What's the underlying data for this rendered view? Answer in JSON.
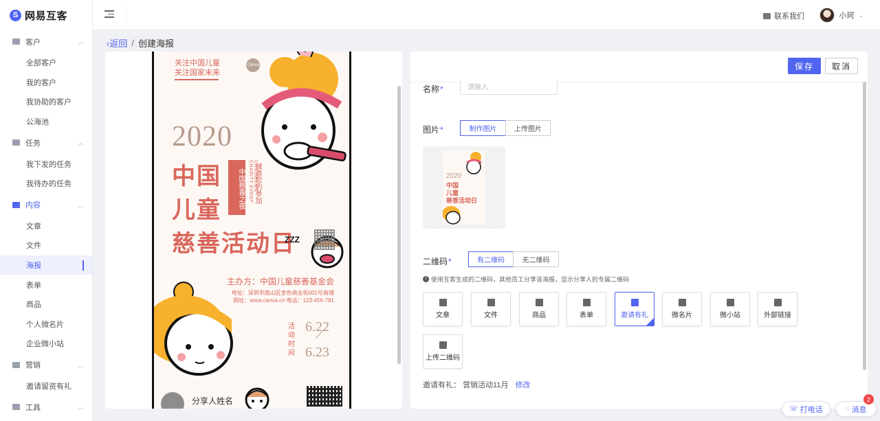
{
  "app": {
    "logo_text": "网易互客"
  },
  "sidebar": {
    "groups": [
      {
        "label": "客户",
        "items": [
          "全部客户",
          "我的客户",
          "我协助的客户",
          "公海池"
        ]
      },
      {
        "label": "任务",
        "items": [
          "我下发的任务",
          "我待办的任务"
        ]
      },
      {
        "label": "内容",
        "items": [
          "文章",
          "文件",
          "海报",
          "表单",
          "商品",
          "个人微名片",
          "企业微小站"
        ]
      },
      {
        "label": "营销",
        "items": [
          "邀请留资有礼"
        ]
      },
      {
        "label": "工具",
        "items": []
      }
    ],
    "active_item": "海报"
  },
  "header": {
    "contact_label": "联系我们",
    "user_name": "小珂"
  },
  "breadcrumb": {
    "back_label": "返回",
    "separator": "/",
    "current": "创建海报"
  },
  "poster": {
    "tag_line_1": "关注中国儿童",
    "tag_line_2": "关注国家未来",
    "logo_text": "Canva",
    "year": "2020",
    "title_line_1": "中国",
    "title_line_2": "儿童",
    "title_line_3": "慈善活动日",
    "vertical_text_1": "中国慈善之夜",
    "vertical_text_2": "诚邀您的参加",
    "english_text": "CHILDREN'S CHARITY EVENT",
    "sleep_text": "ZZZ",
    "host": "主办方：中国儿童慈善基金会",
    "address": "地址：深圳市南山区金色商业街001号商铺",
    "website": "网址：www.canva.cn 电话：123-456-781",
    "date_label": "活动时间",
    "date_start": "6.22",
    "date_end": "6.23",
    "sharer_name": "分享人姓名"
  },
  "form": {
    "save_label": "保存",
    "cancel_label": "取消",
    "name_label": "名称",
    "name_placeholder": "请输入",
    "image_label": "图片",
    "make_image": "制作图片",
    "upload_image": "上传图片",
    "thumb": {
      "year": "2020",
      "line_1": "中国",
      "line_2": "儿童",
      "line_3": "慈善活动日"
    },
    "qr_label": "二维码",
    "qr_yes": "有二维码",
    "qr_no": "无二维码",
    "qr_tip": "使用互客生成的二维码，其他员工分享该海报，显示分享人的专属二维码",
    "types": [
      {
        "label": "文章",
        "icon": "article-icon"
      },
      {
        "label": "文件",
        "icon": "folder-icon"
      },
      {
        "label": "商品",
        "icon": "product-icon"
      },
      {
        "label": "表单",
        "icon": "form-icon"
      },
      {
        "label": "邀请有礼",
        "icon": "gift-icon"
      },
      {
        "label": "微名片",
        "icon": "card-icon"
      },
      {
        "label": "微小站",
        "icon": "home-icon"
      },
      {
        "label": "外部链接",
        "icon": "link-icon"
      },
      {
        "label": "上传二维码",
        "icon": "qrcode-icon"
      }
    ],
    "selected_type": "邀请有礼",
    "gift_label": "邀请有礼：",
    "gift_value": "营销活动11月",
    "gift_edit": "修改"
  },
  "floating": {
    "call_label": "打电话",
    "message_label": "消息",
    "message_badge": "2"
  },
  "colors": {
    "accent": "#5165f0",
    "poster_red": "#d9675c",
    "poster_tan": "#b79b8c"
  }
}
